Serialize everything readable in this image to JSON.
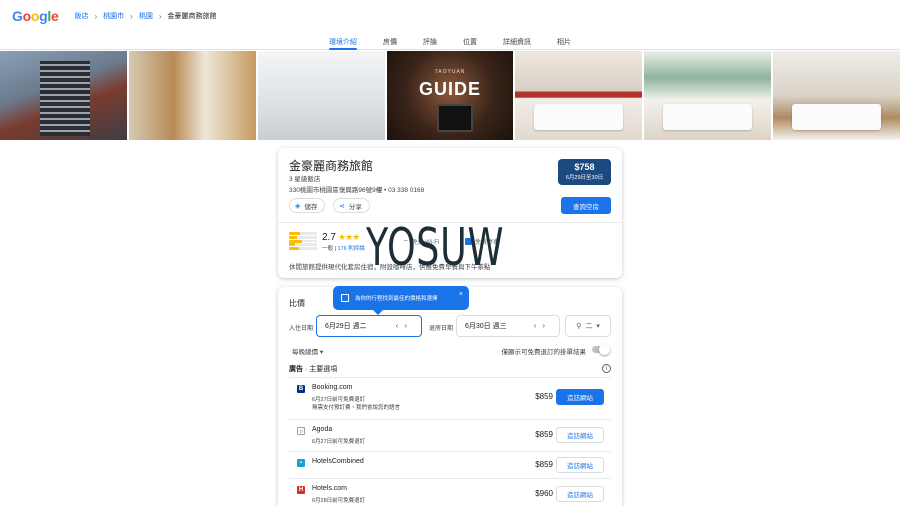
{
  "header": {
    "logo": [
      "G",
      "o",
      "o",
      "g",
      "l",
      "e"
    ],
    "logo_colors": [
      "#4285f4",
      "#ea4335",
      "#fbbc05",
      "#4285f4",
      "#34a853",
      "#ea4335"
    ],
    "breadcrumbs": [
      "飯店",
      "桃園市",
      "桃園",
      "金豪麗商務旅館"
    ]
  },
  "tabs": [
    "環境介紹",
    "房價",
    "評論",
    "位置",
    "詳細資訊",
    "相片"
  ],
  "photos": {
    "sign_text": "GUIDE",
    "sign_sub": "TAOYUAN"
  },
  "hotel": {
    "name": "金豪麗商務旅館",
    "class": "3 星級飯店",
    "address": "330桃園市桃園區復興路96號9樓 • 03 338 0168",
    "price": "$758",
    "price_dates": "6月29日至30日",
    "save_label": "儲存",
    "share_label": "分享",
    "availability_label": "查詢空房",
    "rating": "2.7",
    "stars": "★★★",
    "rating_level": "一般",
    "review_count": "176 則評論",
    "amenity_wifi": "免費 Wi-Fi",
    "amenity_parking": "免費停車",
    "description": "休閒旅館提供現代化套房住宿，附設咖啡店，供應免費早餐與下午茶點",
    "accent": "#1a73e8",
    "price_bg": "#1c4a80"
  },
  "compare": {
    "title": "比價",
    "tooltip": "為你的行程找到最佳的價格和選擇",
    "checkin_label": "入住日期",
    "checkin_value": "6月29日 週二",
    "checkout_label": "退房日期",
    "checkout_value": "6月30日 週三",
    "guests": "二",
    "nightly": "每晚總價",
    "free_cancel_toggle": "僅顯示可免費退訂的掛單結果",
    "ads_label": "廣告",
    "ads_title": "主要選項",
    "offers": [
      {
        "name": "Booking.com",
        "note": "6月27日前可免費退訂",
        "note2": "無需支付預訂費・我們會說您的語言",
        "price": "$859",
        "visit": "造訪網站",
        "color": "#003580",
        "mark": "B",
        "primary": true
      },
      {
        "name": "Agoda",
        "note": "6月27日前可免費退訂",
        "note2": "",
        "price": "$859",
        "visit": "造訪網站",
        "color": "#ffffff",
        "mark": "○",
        "primary": false
      },
      {
        "name": "HotelsCombined",
        "note": "",
        "note2": "",
        "price": "$859",
        "visit": "造訪網站",
        "color": "#1aa0d8",
        "mark": "▪",
        "primary": false
      },
      {
        "name": "Hotels.com",
        "note": "6月28日前可免費退訂",
        "note2": "",
        "price": "$960",
        "visit": "造訪網站",
        "color": "#d32f2f",
        "mark": "H",
        "primary": false
      }
    ]
  },
  "watermark": "YOSUW"
}
